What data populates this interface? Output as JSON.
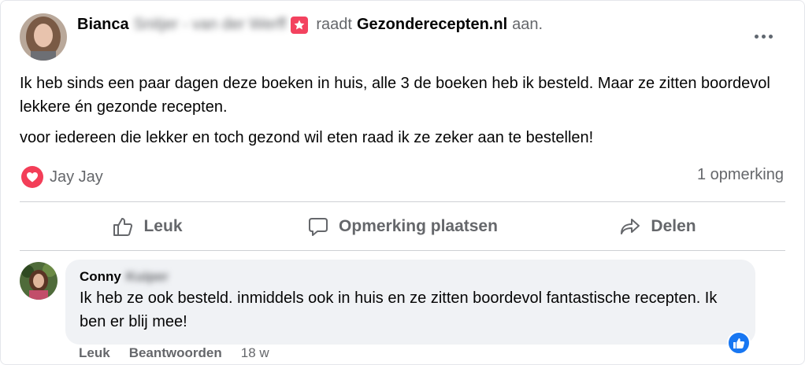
{
  "post": {
    "author_first": "Bianca",
    "author_blurred": "Snitjer - van der Werff",
    "verb": "raadt",
    "page": "Gezonderecepten.nl",
    "suffix": "aan.",
    "paragraph1": "Ik heb sinds een paar dagen deze boeken in huis, alle 3 de boeken heb ik besteld. Maar ze zitten boordevol lekkere én gezonde recepten.",
    "paragraph2": "voor iedereen die lekker en toch gezond wil eten raad ik ze zeker aan te bestellen!",
    "reaction_name": "Jay Jay",
    "comment_count": "1 opmerking"
  },
  "actions": {
    "like": "Leuk",
    "comment": "Opmerking plaatsen",
    "share": "Delen"
  },
  "comment": {
    "author_first": "Conny",
    "author_blurred": "Kuiper",
    "text": "Ik heb ze ook besteld. inmiddels ook in huis en ze zitten boordevol fantastische recepten. Ik ben er blij mee!",
    "like": "Leuk",
    "reply": "Beantwoorden",
    "time": "18 w"
  },
  "icons": {
    "recommend_badge": "star-badge-icon",
    "reaction": "heart-icon",
    "like": "thumbs-up-icon",
    "comment": "comment-bubble-icon",
    "share": "share-arrow-icon",
    "comment_reaction": "like-badge-icon",
    "more": "more-dots-icon"
  },
  "colors": {
    "heart": "#f33e58",
    "badge": "#f3425f",
    "like_blue": "#1877f2",
    "secondary_text": "#65676b"
  }
}
